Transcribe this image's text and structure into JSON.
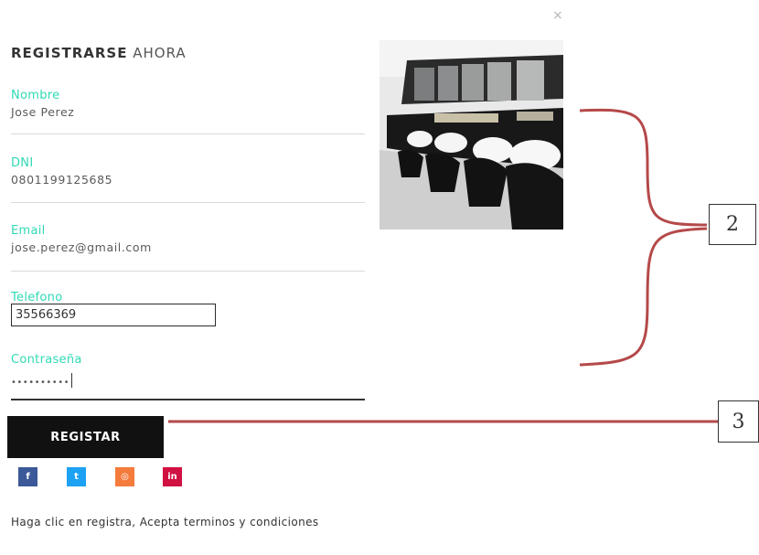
{
  "modal": {
    "close_symbol": "×"
  },
  "form": {
    "title_bold": "REGISTRARSE",
    "title_light": "AHORA",
    "fields": [
      {
        "label": "Nombre",
        "value": "Jose Perez"
      },
      {
        "label": "DNI",
        "value": "0801199125685"
      },
      {
        "label": "Email",
        "value": "jose.perez@gmail.com"
      },
      {
        "label": "Telefono",
        "value": "35566369"
      },
      {
        "label": "Contraseña",
        "value": "••••••••••"
      }
    ],
    "submit_label": "REGISTAR",
    "terms_text": "Haga clic en registra, Acepta terminos y condiciones"
  },
  "social": [
    {
      "name": "facebook",
      "glyph": "f",
      "color": "#3b5998"
    },
    {
      "name": "twitter",
      "glyph": "t",
      "color": "#1da1f2"
    },
    {
      "name": "instagram",
      "glyph": "◎",
      "color": "#f47b3c"
    },
    {
      "name": "linkedin",
      "glyph": "in",
      "color": "#d11141"
    }
  ],
  "annotations": [
    {
      "number": "2"
    },
    {
      "number": "3"
    }
  ],
  "colors": {
    "accent": "#2fd9b5",
    "button": "#111111",
    "annotation_line": "#b5494a"
  }
}
